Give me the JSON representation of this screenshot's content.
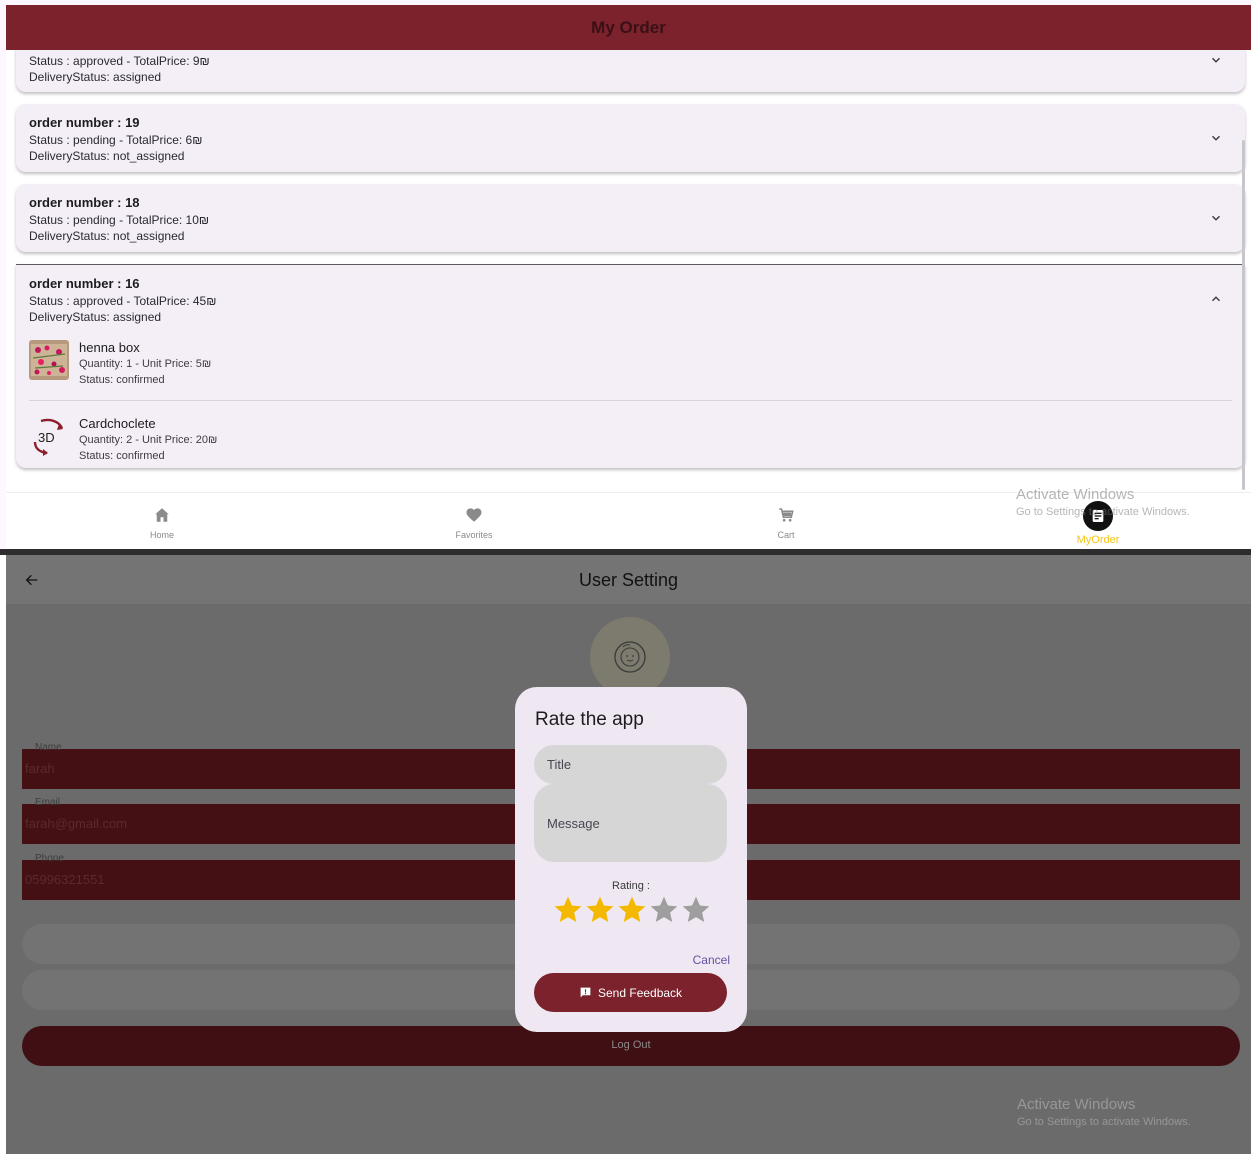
{
  "orders_screen": {
    "app_title": "My Order",
    "orders": [
      {
        "title": "",
        "status_line": "Status : approved - TotalPrice: 9₪",
        "delivery_line": "DeliveryStatus: assigned",
        "expanded": false
      },
      {
        "title": "order number : 19",
        "status_line": "Status : pending - TotalPrice: 6₪",
        "delivery_line": "DeliveryStatus: not_assigned",
        "expanded": false
      },
      {
        "title": "order number : 18",
        "status_line": "Status : pending - TotalPrice: 10₪",
        "delivery_line": "DeliveryStatus: not_assigned",
        "expanded": false
      },
      {
        "title": "order number : 16",
        "status_line": "Status : approved - TotalPrice: 45₪",
        "delivery_line": "DeliveryStatus: assigned",
        "expanded": true,
        "items": [
          {
            "name": "henna box",
            "quantity_line": "Quantity: 1  - Unit Price: 5₪",
            "status_line": "Status: confirmed",
            "thumb_icon": "henna-box-thumbnail"
          },
          {
            "name": "Cardchoclete",
            "quantity_line": "Quantity: 2 - Unit Price: 20₪",
            "status_line": "Status: confirmed",
            "thumb_icon": "3d-rotate-icon",
            "thumb_text": "3D"
          }
        ]
      }
    ],
    "bottom_nav": [
      {
        "label": "Home",
        "icon": "home-icon",
        "active": false
      },
      {
        "label": "Favorites",
        "icon": "heart-icon",
        "active": false
      },
      {
        "label": "Cart",
        "icon": "cart-icon",
        "active": false
      },
      {
        "label": "MyOrder",
        "icon": "orders-icon",
        "active": true
      }
    ],
    "watermark": {
      "title": "Activate Windows",
      "subtitle": "Go to Settings to activate Windows."
    }
  },
  "settings_screen": {
    "app_title": "User Setting",
    "back_icon": "back-arrow-icon",
    "avatar_icon": "face-avatar-icon",
    "fields": [
      {
        "label": "Name",
        "value": "farah"
      },
      {
        "label": "Email",
        "value": "farah@gmail.com"
      },
      {
        "label": "Phone",
        "value": "05996321551"
      }
    ],
    "logout_label": "Log Out",
    "watermark": {
      "title": "Activate Windows",
      "subtitle": "Go to Settings to activate Windows."
    }
  },
  "rate_dialog": {
    "title": "Rate the app",
    "title_placeholder": "Title",
    "message_placeholder": "Message",
    "rating_label": "Rating :",
    "rating_value": 3,
    "rating_max": 5,
    "cancel_label": "Cancel",
    "send_label": "Send Feedback",
    "send_icon": "feedback-icon",
    "colors": {
      "star_filled": "#f5b800",
      "star_empty": "#9e9e9e",
      "accent": "#7b222d"
    }
  }
}
